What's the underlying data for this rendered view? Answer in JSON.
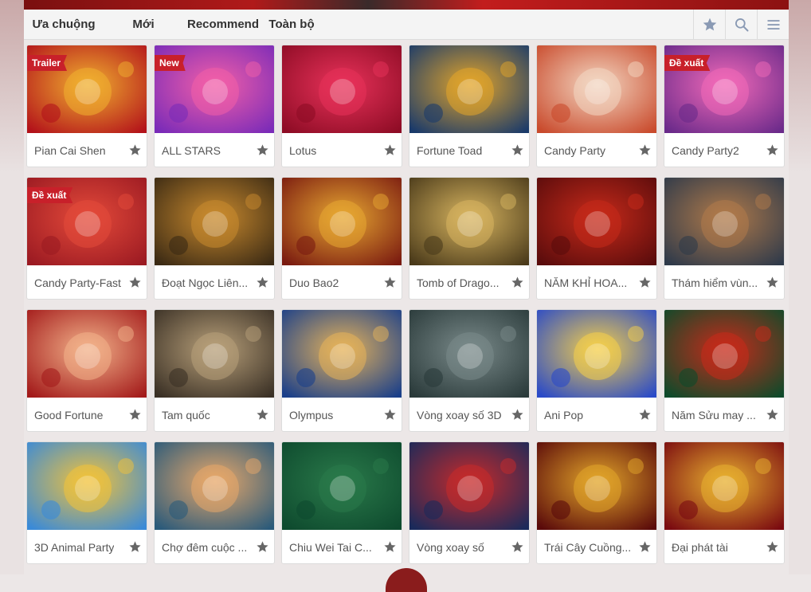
{
  "tabs": [
    {
      "label": "Ưa chuộng",
      "active": true
    },
    {
      "label": "Mới",
      "active": false
    },
    {
      "label": "Recommend",
      "active": false
    },
    {
      "label": "Toàn bộ",
      "active": false
    }
  ],
  "tools": [
    {
      "icon": "star-icon"
    },
    {
      "icon": "search-icon"
    },
    {
      "icon": "menu-icon"
    }
  ],
  "colors": {
    "ribbon": "#c8202a",
    "star": "#666666",
    "tool_icon": "#8a9ab4"
  },
  "games": [
    {
      "name": "Pian Cai Shen",
      "badge": "Trailer",
      "art": [
        "#b3121a",
        "#f0b030"
      ],
      "icon": "god-of-wealth-icon"
    },
    {
      "name": "ALL STARS",
      "badge": "New",
      "art": [
        "#7a2bb8",
        "#f25fa8"
      ],
      "icon": "star-logo-icon"
    },
    {
      "name": "Lotus",
      "badge": "",
      "art": [
        "#8e0c25",
        "#e8325a"
      ],
      "icon": "lotus-icon"
    },
    {
      "name": "Fortune Toad",
      "badge": "",
      "art": [
        "#1a3a6a",
        "#e3a52a"
      ],
      "icon": "toad-icon"
    },
    {
      "name": "Candy Party",
      "badge": "",
      "art": [
        "#c94a2c",
        "#f3d7c2"
      ],
      "icon": "candy-icon"
    },
    {
      "name": "Candy Party2",
      "badge": "Đề xuất",
      "art": [
        "#6a2a8a",
        "#f26ab8"
      ],
      "icon": "candy-wheel-icon"
    },
    {
      "name": "Candy Party-Fast",
      "badge": "Đề xuất",
      "art": [
        "#9b1a22",
        "#e44a3a"
      ],
      "icon": "candy-ball-icon"
    },
    {
      "name": "Đoạt Ngọc Liên...",
      "badge": "",
      "art": [
        "#3b2a14",
        "#c98a2e"
      ],
      "icon": "gem-icon"
    },
    {
      "name": "Duo Bao2",
      "badge": "",
      "art": [
        "#7a1a10",
        "#e7a832"
      ],
      "icon": "dragon-icon"
    },
    {
      "name": "Tomb of Drago...",
      "badge": "",
      "art": [
        "#4a3a1a",
        "#d8b560"
      ],
      "icon": "tomb-icon"
    },
    {
      "name": "NĂM KHỈ HOA...",
      "badge": "",
      "art": [
        "#5a0c0c",
        "#c72a1a"
      ],
      "icon": "red-envelope-icon"
    },
    {
      "name": "Thám hiểm vùn...",
      "badge": "",
      "art": [
        "#2f3a4a",
        "#b07a4a"
      ],
      "icon": "explorer-icon"
    },
    {
      "name": "Good Fortune",
      "badge": "",
      "art": [
        "#a31a1a",
        "#f2b28a"
      ],
      "icon": "fortune-kids-icon"
    },
    {
      "name": "Tam quốc",
      "badge": "",
      "art": [
        "#3a3025",
        "#b8a07a"
      ],
      "icon": "warriors-icon"
    },
    {
      "name": "Olympus",
      "badge": "",
      "art": [
        "#1a3f8a",
        "#e6b35a"
      ],
      "icon": "zeus-icon"
    },
    {
      "name": "Vòng xoay số 3D",
      "badge": "",
      "art": [
        "#2a3a3a",
        "#7a8a8a"
      ],
      "icon": "dial-icon"
    },
    {
      "name": "Ani Pop",
      "badge": "",
      "art": [
        "#2a4ac8",
        "#f5d04a"
      ],
      "icon": "chick-icon"
    },
    {
      "name": "Năm Sửu may ...",
      "badge": "",
      "art": [
        "#0e4a2a",
        "#c72a1a"
      ],
      "icon": "red-envelope-icon"
    },
    {
      "name": "3D Animal Party",
      "badge": "",
      "art": [
        "#3a8ad8",
        "#f2c23a"
      ],
      "icon": "panda-icon"
    },
    {
      "name": "Chợ đêm cuộc ...",
      "badge": "",
      "art": [
        "#2a5a7a",
        "#e8a86a"
      ],
      "icon": "market-icon"
    },
    {
      "name": "Chiu Wei Tai C...",
      "badge": "",
      "art": [
        "#0e4a2e",
        "#2a7a4a"
      ],
      "icon": "billiard-ball-icon"
    },
    {
      "name": "Vòng xoay số",
      "badge": "",
      "art": [
        "#1a2a5a",
        "#c72a2a"
      ],
      "icon": "roulette-chip-icon"
    },
    {
      "name": "Trái Cây Cuồng...",
      "badge": "",
      "art": [
        "#5a0a0a",
        "#e2a52a"
      ],
      "icon": "fruit-icon"
    },
    {
      "name": "Đại phát tài",
      "badge": "",
      "art": [
        "#7a0a10",
        "#e8b030"
      ],
      "icon": "gold-pot-icon"
    }
  ]
}
